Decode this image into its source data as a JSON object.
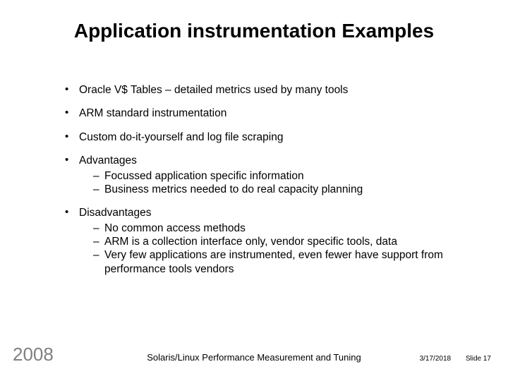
{
  "title": "Application instrumentation Examples",
  "bullets": {
    "b1": "Oracle V$ Tables – detailed metrics used by many tools",
    "b2": "ARM standard instrumentation",
    "b3": "Custom do-it-yourself and log file scraping",
    "b4": {
      "label": "Advantages",
      "sub": [
        "Focussed application specific information",
        "Business metrics needed to do real capacity planning"
      ]
    },
    "b5": {
      "label": "Disadvantages",
      "sub": [
        "No common access methods",
        "ARM is a collection interface only, vendor specific tools, data",
        "Very few applications are instrumented, even fewer have support from performance tools vendors"
      ]
    }
  },
  "footer": {
    "year": "2008",
    "center": "Solaris/Linux Performance Measurement and Tuning",
    "date": "3/17/2018",
    "slide": "Slide 17"
  }
}
